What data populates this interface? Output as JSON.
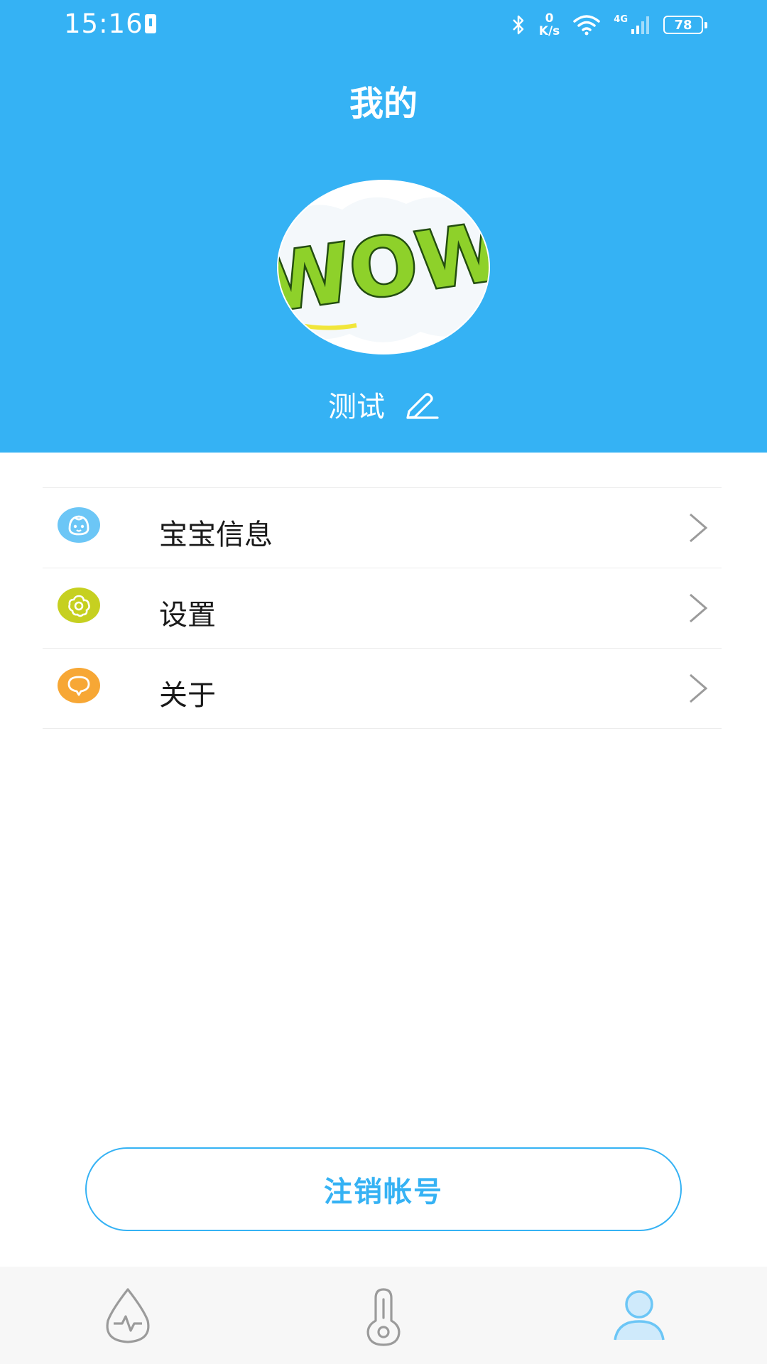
{
  "status_bar": {
    "time": "15:16",
    "net_speed_value": "0",
    "net_speed_unit": "K/s",
    "network_gen": "4G",
    "battery": "78"
  },
  "header": {
    "title": "我的",
    "avatar_icon": "wow-avatar-image",
    "user_name": "测试",
    "edit_icon": "pencil-icon",
    "background_color": "#35b2f4"
  },
  "menu": {
    "items": [
      {
        "label": "宝宝信息",
        "icon": "baby-face-icon",
        "icon_color": "#6cc6f6"
      },
      {
        "label": "设置",
        "icon": "flower-gear-icon",
        "icon_color": "#c6d020"
      },
      {
        "label": "关于",
        "icon": "speech-bubble-icon",
        "icon_color": "#f7a735"
      }
    ]
  },
  "logout_label": "注销帐号",
  "tab_bar": {
    "tabs": [
      {
        "icon": "drop-pulse-icon",
        "active": false
      },
      {
        "icon": "thermometer-icon",
        "active": false
      },
      {
        "icon": "person-icon",
        "active": true
      }
    ],
    "active_color": "#6cc6f6",
    "inactive_color": "#9b9b9b"
  }
}
